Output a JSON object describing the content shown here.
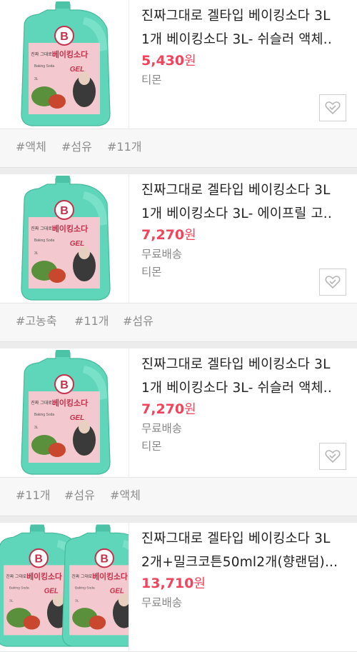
{
  "products": [
    {
      "title_line1": "진짜그대로 겔타입 베이킹소다 3L",
      "title_line2": "1개 베이킹소다 3L- 쉬슬러 액체..",
      "price": "5,430",
      "currency": "원",
      "shipping": "",
      "seller": "티몬",
      "tags": [
        "#액체",
        "#섬유",
        "#11개"
      ],
      "image_count": 1
    },
    {
      "title_line1": "진짜그대로 겔타입 베이킹소다 3L",
      "title_line2": "1개 베이킹소다 3L- 에이프릴 고..",
      "price": "7,270",
      "currency": "원",
      "shipping": "무료배송",
      "seller": "티몬",
      "tags": [
        "#고농축",
        "#11개",
        "#섬유"
      ],
      "image_count": 1
    },
    {
      "title_line1": "진짜그대로 겔타입 베이킹소다 3L",
      "title_line2": "1개 베이킹소다 3L- 쉬슬러 액체..",
      "price": "7,270",
      "currency": "원",
      "shipping": "무료배송",
      "seller": "티몬",
      "tags": [
        "#11개",
        "#섬유",
        "#액체"
      ],
      "image_count": 1
    },
    {
      "title_line1": "진짜그대로 겔타입 베이킹소다 3L",
      "title_line2": "2개+밀크코튼50ml2개(향랜덤)...",
      "price": "13,710",
      "currency": "원",
      "shipping": "무료배송",
      "seller": "",
      "tags": [],
      "image_count": 2
    }
  ],
  "product_label": {
    "brand_letter": "B",
    "name_small": "진짜 그대로",
    "name": "베이킹소다",
    "sub": "Baking Soda",
    "gel": "GEL",
    "volume": "3L"
  },
  "colors": {
    "price": "#f2435b",
    "bottle": "#5fd6b9",
    "label": "#f3c9cf"
  },
  "icons": {
    "wishlist": "heart-outline-icon"
  }
}
